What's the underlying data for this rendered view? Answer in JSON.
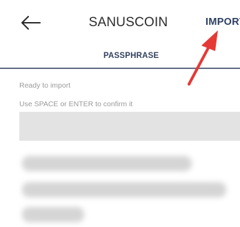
{
  "app_bar": {
    "back_icon": "arrow-left-icon",
    "title": "SANUSCOIN",
    "import_label": "IMPORT"
  },
  "tabs": [
    {
      "label": "PASSPHRASE",
      "active": true
    }
  ],
  "form": {
    "status_text": "Ready to import",
    "hint_text": "Use SPACE or ENTER to confirm it",
    "input_value": "",
    "input_placeholder": ""
  },
  "annotation": {
    "arrow_icon": "red-pointer-arrow-icon",
    "arrow_color": "#e53935"
  },
  "colors": {
    "accent": "#2c3e63",
    "tab_underline": "#5f6a83",
    "input_background": "#e3e3e3",
    "muted_text": "#9a9a9a"
  }
}
